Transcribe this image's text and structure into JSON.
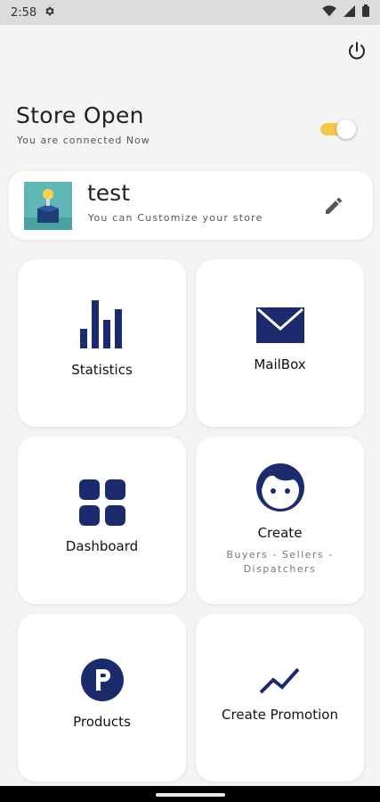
{
  "status_bar": {
    "time": "2:58",
    "icons": [
      "settings-icon",
      "wifi-icon",
      "signal-icon",
      "battery-icon"
    ]
  },
  "header": {
    "power_icon": "power-icon"
  },
  "store_status": {
    "title": "Store Open",
    "subtitle": "You are connected Now",
    "toggle_on": true
  },
  "store_card": {
    "name": "test",
    "description": "You can Customize your store",
    "edit_icon": "pencil-icon"
  },
  "tiles": {
    "statistics": {
      "label": "Statistics",
      "icon": "bar-chart-icon"
    },
    "mailbox": {
      "label": "MailBox",
      "icon": "envelope-icon"
    },
    "dashboard": {
      "label": "Dashboard",
      "icon": "grid-icon"
    },
    "create": {
      "label": "Create",
      "sublabel": "Buyers - Sellers - Dispatchers",
      "icon": "face-icon"
    },
    "products": {
      "label": "Products",
      "icon": "parking-p-icon"
    },
    "create_promotion": {
      "label": "Create Promotion",
      "icon": "trending-up-icon"
    }
  },
  "colors": {
    "accent_navy": "#1c2a6e",
    "toggle_yellow": "#f2c94c",
    "background": "#f4f4f4",
    "card": "#ffffff"
  }
}
